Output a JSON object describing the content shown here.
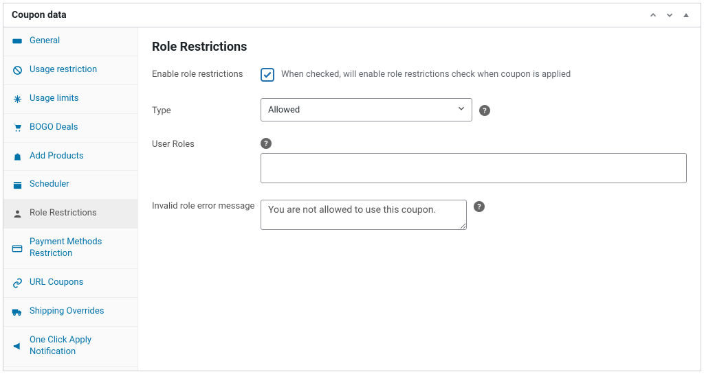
{
  "header": {
    "title": "Coupon data"
  },
  "sidebar": {
    "items": [
      {
        "label": "General",
        "icon": "ticket",
        "active": false
      },
      {
        "label": "Usage restriction",
        "icon": "ban",
        "active": false
      },
      {
        "label": "Usage limits",
        "icon": "adjust",
        "active": false
      },
      {
        "label": "BOGO Deals",
        "icon": "cart",
        "active": false
      },
      {
        "label": "Add Products",
        "icon": "bag",
        "active": false
      },
      {
        "label": "Scheduler",
        "icon": "calendar",
        "active": false
      },
      {
        "label": "Role Restrictions",
        "icon": "user",
        "active": true
      },
      {
        "label": "Payment Methods Restriction",
        "icon": "card",
        "active": false
      },
      {
        "label": "URL Coupons",
        "icon": "link",
        "active": false
      },
      {
        "label": "Shipping Overrides",
        "icon": "truck",
        "active": false
      },
      {
        "label": "One Click Apply Notification",
        "icon": "megaphone",
        "active": false
      }
    ]
  },
  "content": {
    "heading": "Role Restrictions",
    "enable": {
      "label": "Enable role restrictions",
      "checked": true,
      "help": "When checked, will enable role restrictions check when coupon is applied"
    },
    "type": {
      "label": "Type",
      "value": "Allowed"
    },
    "user_roles": {
      "label": "User Roles",
      "value": ""
    },
    "error_msg": {
      "label": "Invalid role error message",
      "value": "You are not allowed to use this coupon."
    }
  }
}
